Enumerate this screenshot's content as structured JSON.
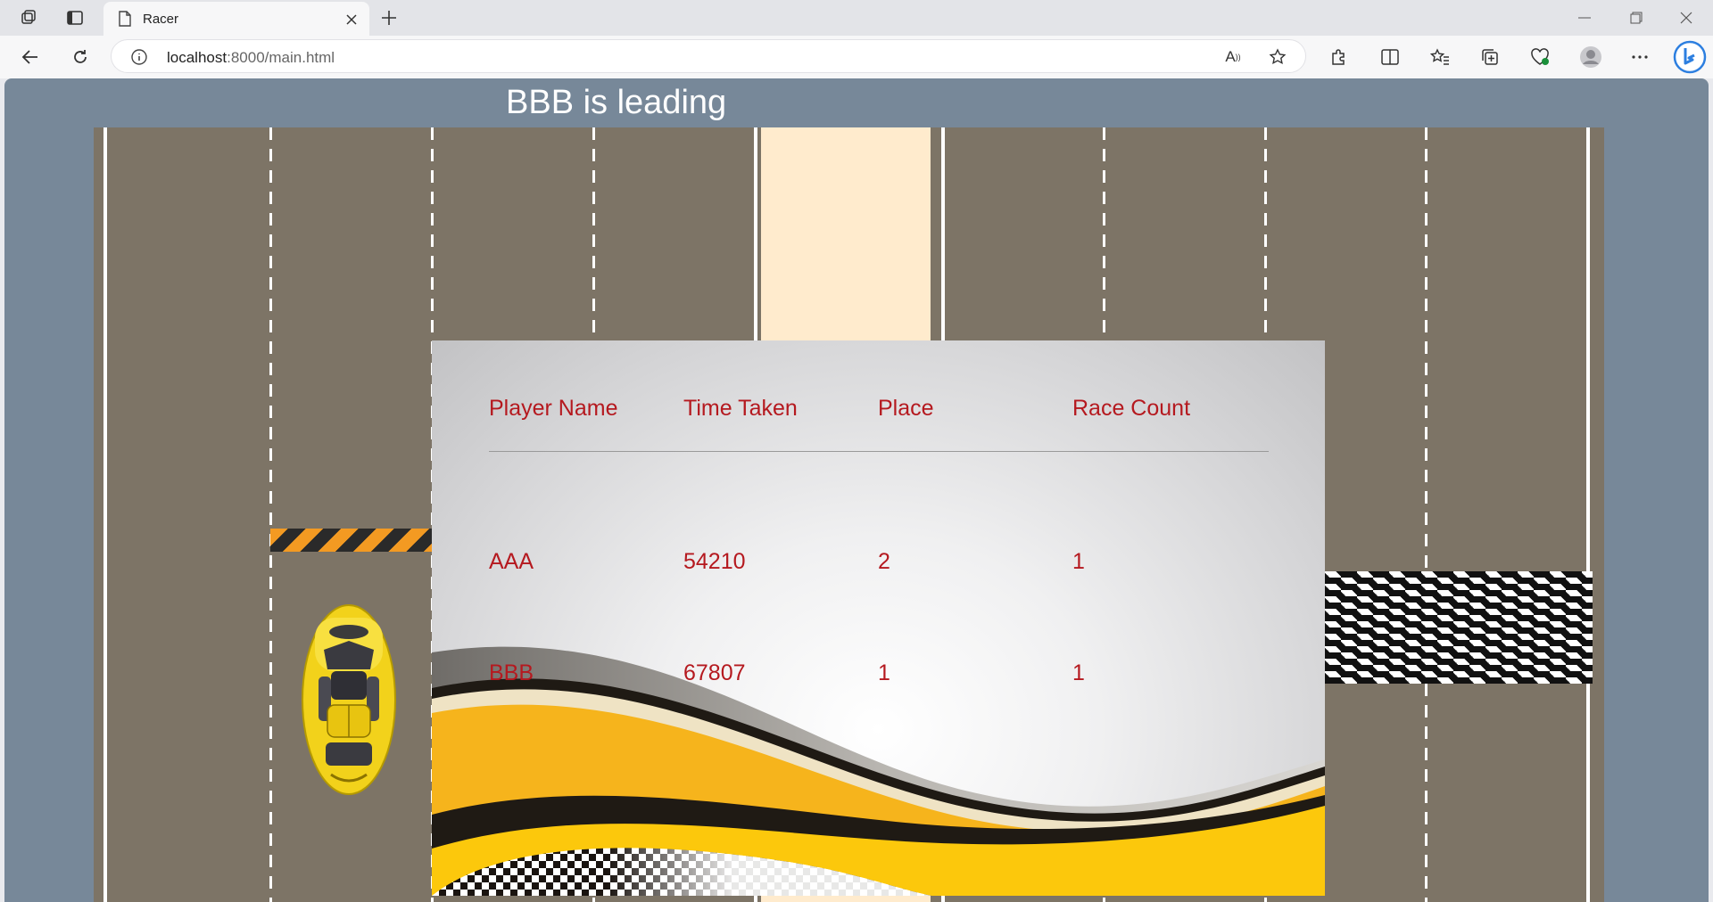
{
  "browser": {
    "tab_title": "Racer",
    "url_host": "localhost",
    "url_rest": ":8000/main.html",
    "icons": [
      "workspaces-icon",
      "tab-actions-icon",
      "page-icon",
      "close-tab-icon",
      "new-tab-icon",
      "back-icon",
      "refresh-icon",
      "info-icon",
      "read-aloud-icon",
      "favorite-star-icon",
      "extensions-icon",
      "split-screen-icon",
      "favorites-icon",
      "collections-icon",
      "browser-essentials-icon",
      "profile-icon",
      "more-icon",
      "copilot-icon",
      "minimize-icon",
      "restore-icon",
      "close-window-icon"
    ]
  },
  "game": {
    "status": "BBB is leading",
    "colors": {
      "background": "#778899",
      "road": "#7d7466",
      "median": "#ffebcd",
      "text": "#b5191f"
    }
  },
  "results": {
    "headers": [
      "Player Name",
      "Time Taken",
      "Place",
      "Race Count"
    ],
    "rows": [
      [
        "AAA",
        "54210",
        "2",
        "1"
      ],
      [
        "BBB",
        "67807",
        "1",
        "1"
      ]
    ]
  }
}
